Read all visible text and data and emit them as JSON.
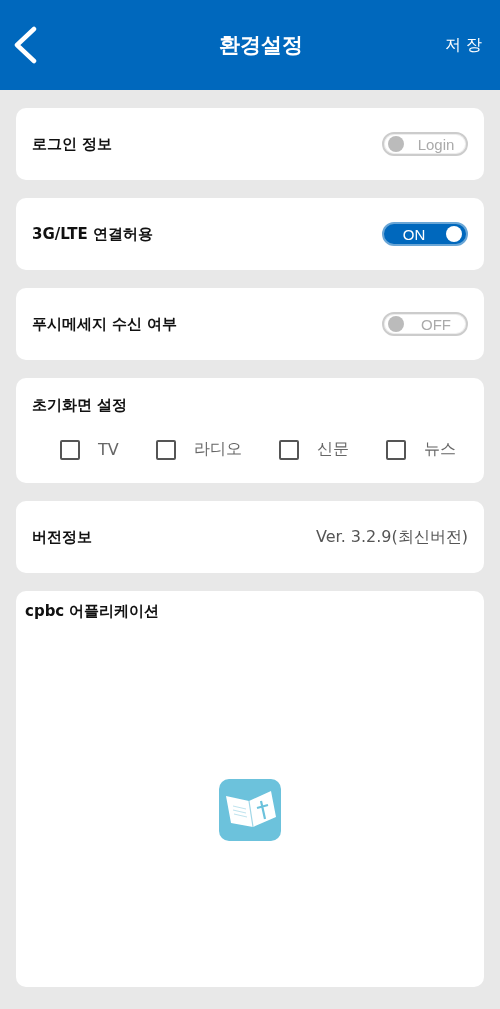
{
  "header": {
    "title": "환경설정",
    "action": "저 장"
  },
  "toggles": [
    {
      "label": "로그인 정보",
      "switch_text": "Login",
      "on": false
    },
    {
      "label": "3G/LTE 연결허용",
      "switch_text": "ON",
      "on": true
    },
    {
      "label": "푸시메세지 수신 여부",
      "switch_text": "OFF",
      "on": false
    }
  ],
  "start_screen": {
    "label": "초기화면 설정",
    "options": [
      {
        "label": "TV",
        "checked": false
      },
      {
        "label": "라디오",
        "checked": false
      },
      {
        "label": "신문",
        "checked": false
      },
      {
        "label": "뉴스",
        "checked": false
      }
    ]
  },
  "version": {
    "label": "버전정보",
    "value": "Ver. 3.2.9(최신버전)"
  },
  "app": {
    "label": "cpbc 어플리케이션"
  }
}
